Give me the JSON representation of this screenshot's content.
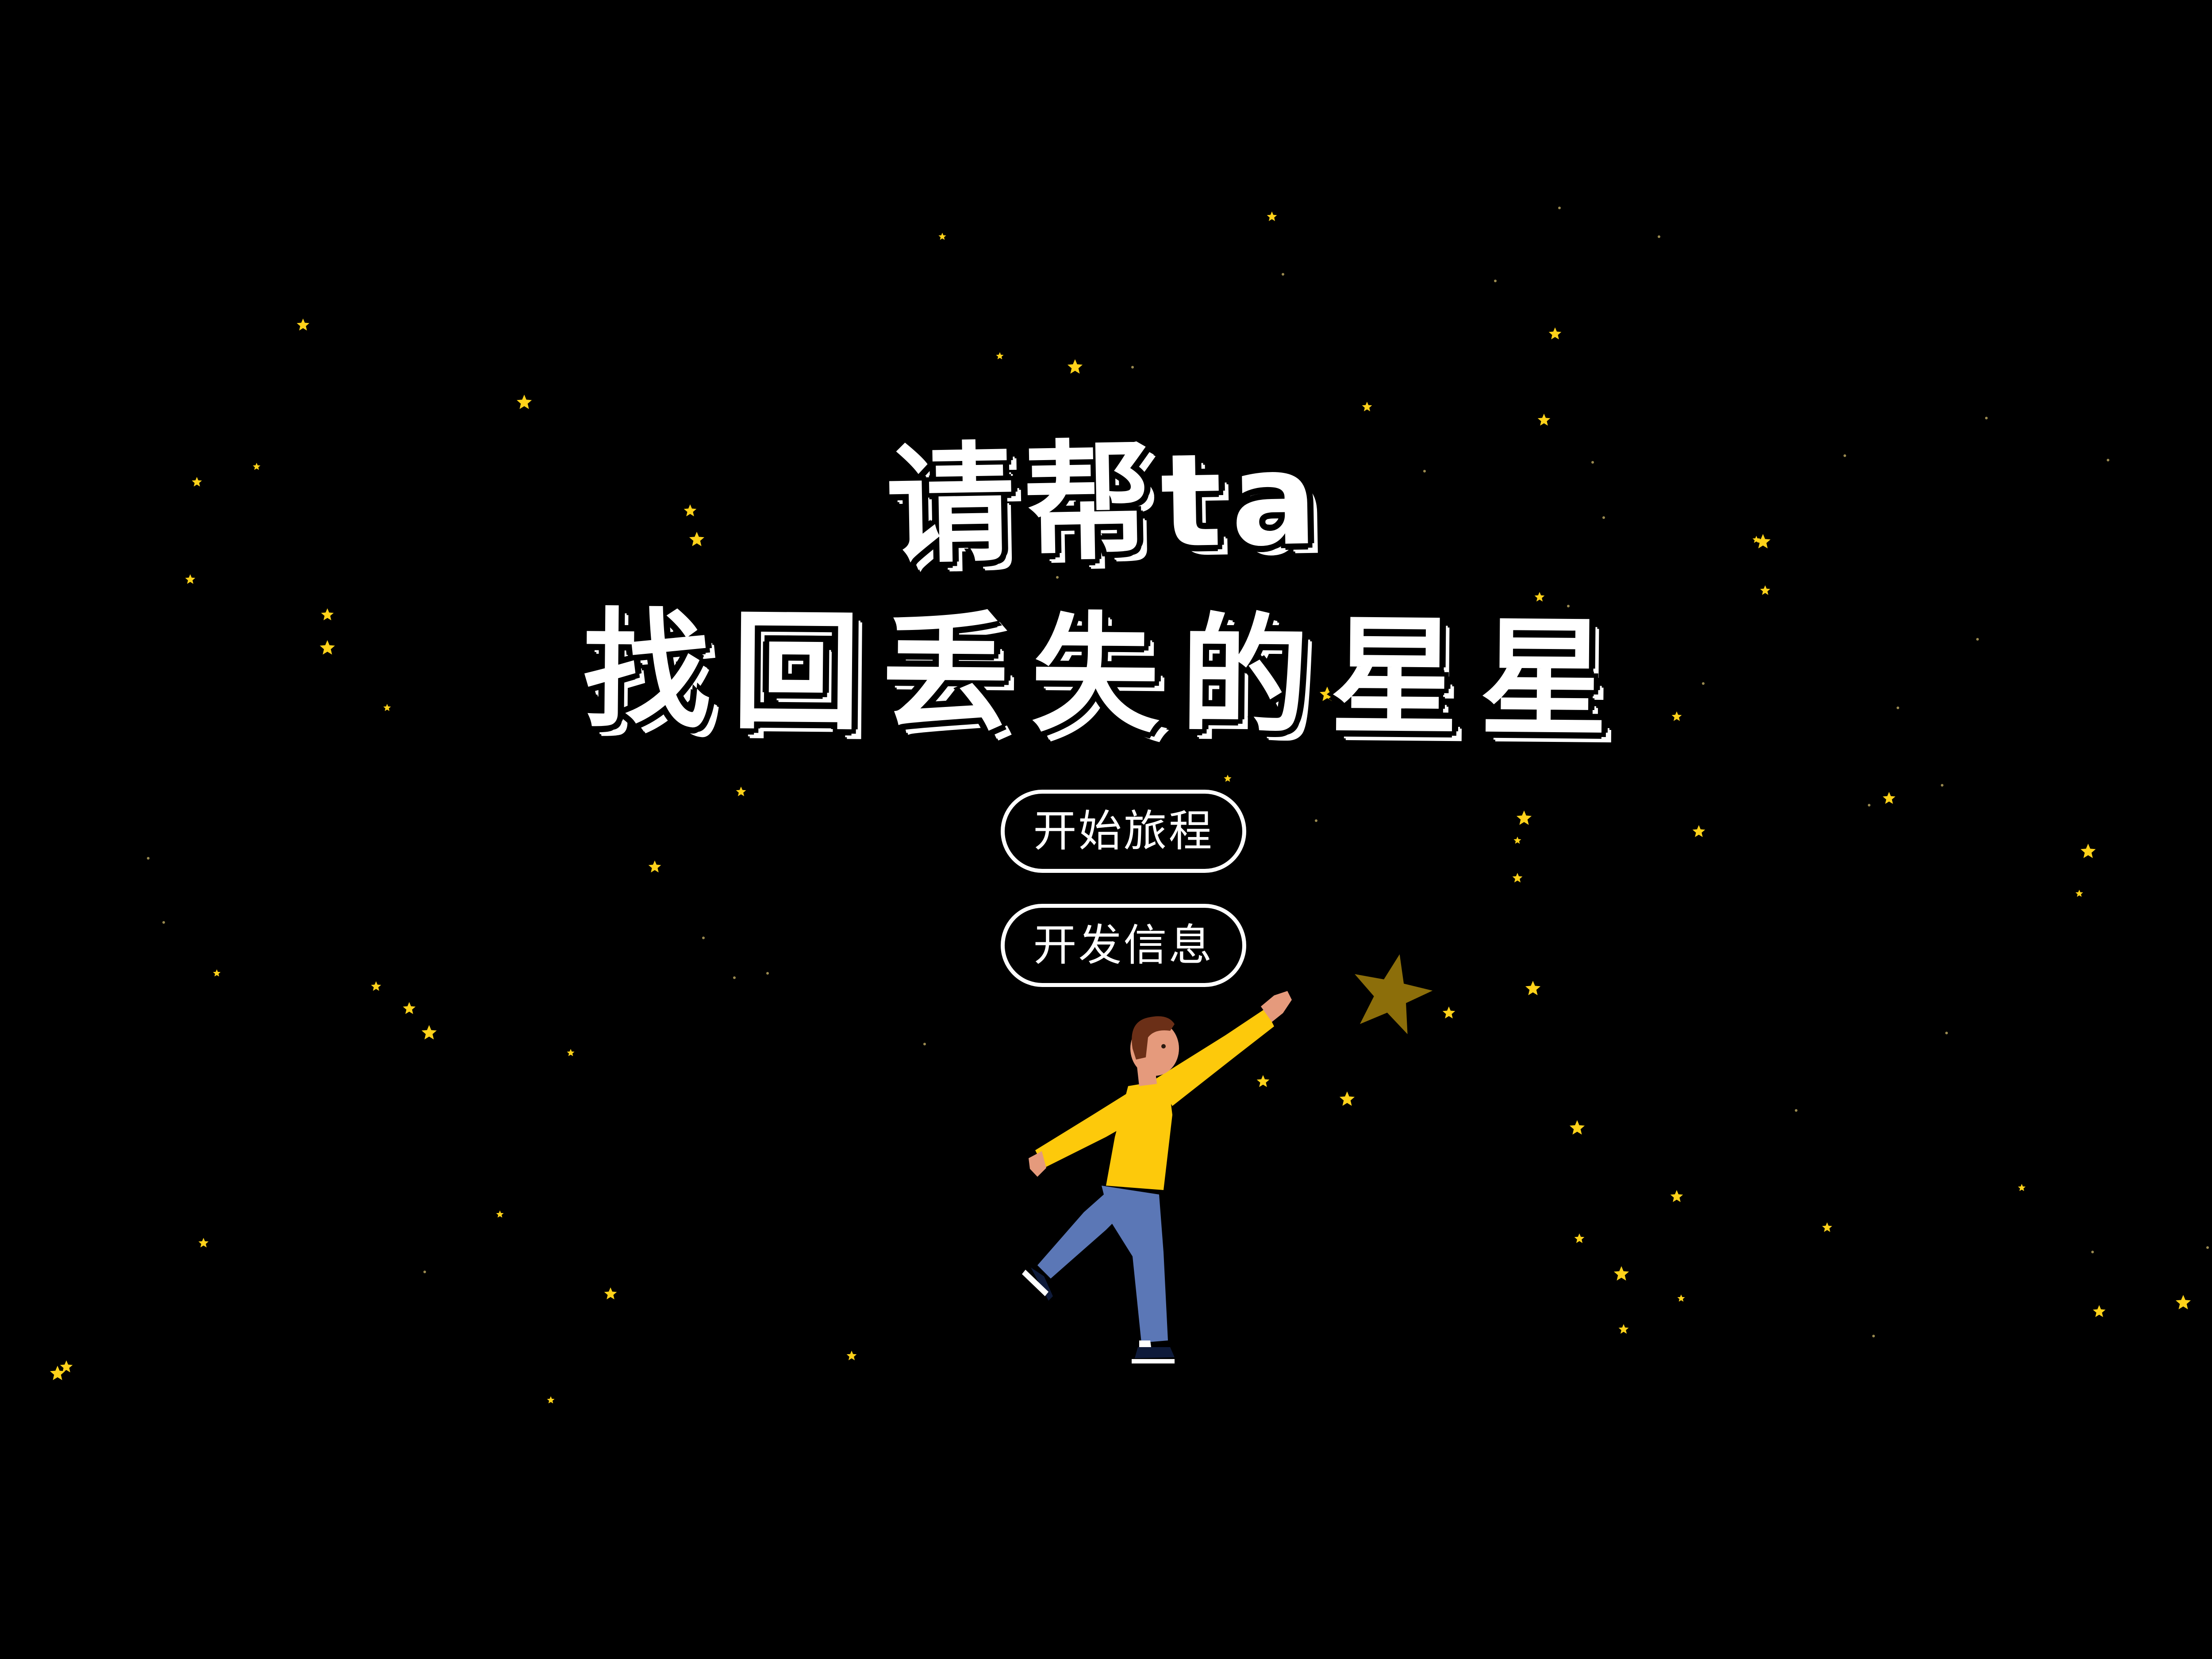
{
  "title": {
    "line1": "请帮ta",
    "line2": "找回丢失的星星"
  },
  "menu": {
    "start_label": "开始旅程",
    "dev_info_label": "开发信息"
  },
  "colors": {
    "background": "#000000",
    "star": "#ffd21a",
    "lost_star": "#8c6e0a",
    "shirt": "#fdc90b",
    "pants": "#5b77b6",
    "skin": "#e59a7c",
    "hair": "#6b2f17",
    "shoes": "#0e1a3a"
  },
  "icons": {
    "stars": "star-icon",
    "character": "reaching-person-illustration",
    "lost_star": "lost-star-icon"
  }
}
